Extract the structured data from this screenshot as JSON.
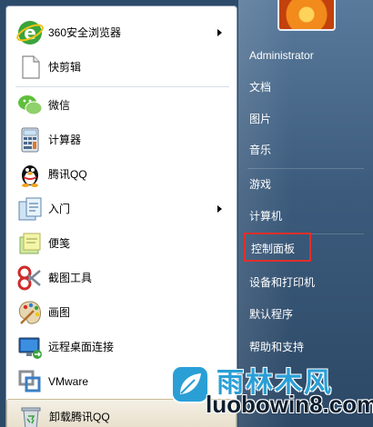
{
  "left_items": [
    {
      "label": "360安全浏览器",
      "icon": "ie-360-browser-icon",
      "arrow": true
    },
    {
      "label": "快剪辑",
      "icon": "document-icon",
      "arrow": false
    },
    {
      "label": "微信",
      "icon": "wechat-icon",
      "arrow": false
    },
    {
      "label": "计算器",
      "icon": "calculator-icon",
      "arrow": false
    },
    {
      "label": "腾讯QQ",
      "icon": "qq-penguin-icon",
      "arrow": false
    },
    {
      "label": "入门",
      "icon": "getting-started-icon",
      "arrow": true
    },
    {
      "label": "便笺",
      "icon": "sticky-notes-icon",
      "arrow": false
    },
    {
      "label": "截图工具",
      "icon": "snipping-tool-icon",
      "arrow": false
    },
    {
      "label": "画图",
      "icon": "paint-palette-icon",
      "arrow": false
    },
    {
      "label": "远程桌面连接",
      "icon": "remote-desktop-icon",
      "arrow": false
    },
    {
      "label": "VMware",
      "icon": "vmware-icon",
      "arrow": false
    },
    {
      "label": "卸载腾讯QQ",
      "icon": "recycle-bin-icon",
      "arrow": false
    }
  ],
  "right_items": [
    {
      "label": "Administrator"
    },
    {
      "label": "文档"
    },
    {
      "label": "图片"
    },
    {
      "label": "音乐"
    },
    {
      "label": "游戏"
    },
    {
      "label": "计算机"
    },
    {
      "label": "控制面板",
      "highlighted": true
    },
    {
      "label": "设备和打印机"
    },
    {
      "label": "默认程序"
    },
    {
      "label": "帮助和支持"
    }
  ],
  "watermark": {
    "title": "雨林木风",
    "url": "luobowin8.com"
  },
  "colors": {
    "highlight_box": "#e0302a",
    "watermark_blue": "#2a9fd6",
    "right_pane": "#3c5b7c"
  }
}
